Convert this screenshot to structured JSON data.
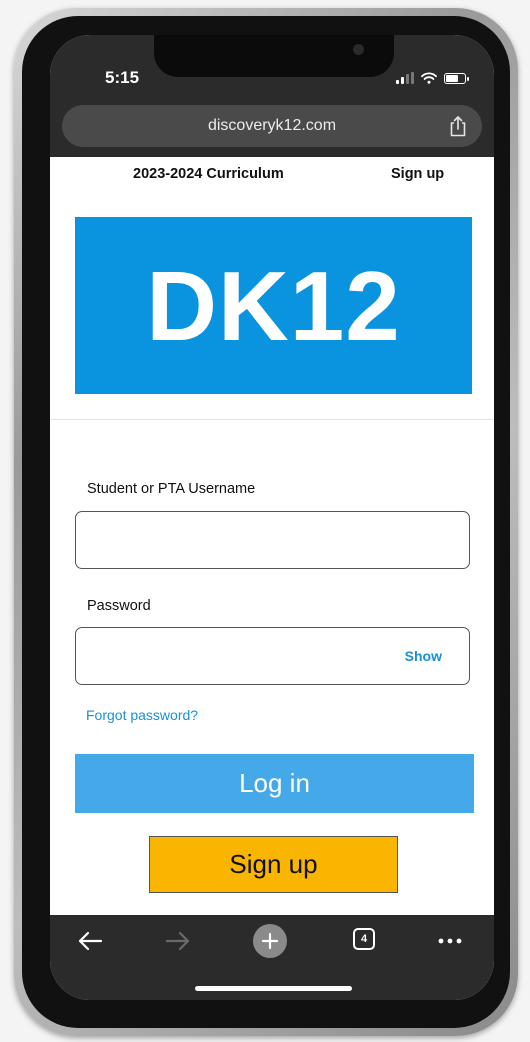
{
  "status_bar": {
    "time": "5:15"
  },
  "browser": {
    "url": "discoveryk12.com",
    "tab_count": "4"
  },
  "page": {
    "top_links": {
      "curriculum": "2023-2024 Curriculum",
      "sign_up": "Sign up"
    },
    "logo": {
      "text": "DK12",
      "bg_color": "#0a93df"
    },
    "form": {
      "username_label": "Student or PTA Username",
      "username_value": "",
      "password_label": "Password",
      "password_value": "",
      "show_label": "Show",
      "forgot_label": "Forgot password?",
      "login_label": "Log in",
      "signup_label": "Sign up"
    },
    "colors": {
      "login_button": "#45a8e8",
      "signup_button": "#f9b500",
      "link": "#1a8fd6"
    }
  },
  "toolbar": {
    "icons": [
      "back-arrow-icon",
      "forward-arrow-icon",
      "new-tab-plus-icon",
      "tabs-icon",
      "more-icon"
    ]
  }
}
